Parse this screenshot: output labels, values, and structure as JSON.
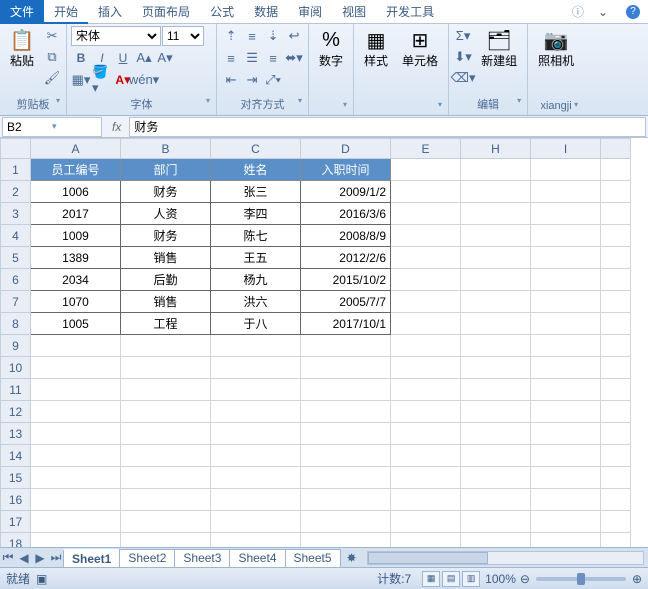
{
  "tabs": {
    "file": "文件",
    "items": [
      "开始",
      "插入",
      "页面布局",
      "公式",
      "数据",
      "审阅",
      "视图",
      "开发工具"
    ],
    "active": 0
  },
  "ribbon": {
    "clipboard": {
      "paste": "粘贴",
      "label": "剪贴板"
    },
    "font": {
      "name": "宋体",
      "size": "11",
      "label": "字体"
    },
    "align": {
      "label": "对齐方式"
    },
    "number": {
      "btn": "数字",
      "label": ""
    },
    "styles": {
      "fmt": "样式",
      "cell": "单元格",
      "label": ""
    },
    "edit": {
      "newgroup": "新建组",
      "label": "编辑"
    },
    "camera": {
      "btn": "照相机",
      "label": "xiangji"
    }
  },
  "fbar": {
    "name": "B2",
    "fx": "fx",
    "value": "财务"
  },
  "columns": [
    "A",
    "B",
    "C",
    "D",
    "E",
    "H",
    "I"
  ],
  "headers": [
    "员工编号",
    "部门",
    "姓名",
    "入职时间"
  ],
  "rows": [
    {
      "id": "1006",
      "dept": "财务",
      "name": "张三",
      "date": "2009/1/2"
    },
    {
      "id": "2017",
      "dept": "人资",
      "name": "李四",
      "date": "2016/3/6"
    },
    {
      "id": "1009",
      "dept": "财务",
      "name": "陈七",
      "date": "2008/8/9"
    },
    {
      "id": "1389",
      "dept": "销售",
      "name": "王五",
      "date": "2012/2/6"
    },
    {
      "id": "2034",
      "dept": "后勤",
      "name": "杨九",
      "date": "2015/10/2"
    },
    {
      "id": "1070",
      "dept": "销售",
      "name": "洪六",
      "date": "2005/7/7"
    },
    {
      "id": "1005",
      "dept": "工程",
      "name": "于八",
      "date": "2017/10/1"
    }
  ],
  "sheets": [
    "Sheet1",
    "Sheet2",
    "Sheet3",
    "Sheet4",
    "Sheet5"
  ],
  "status": {
    "ready": "就绪",
    "rec": "",
    "count_label": "计数:",
    "count": "7",
    "zoom": "100%"
  }
}
